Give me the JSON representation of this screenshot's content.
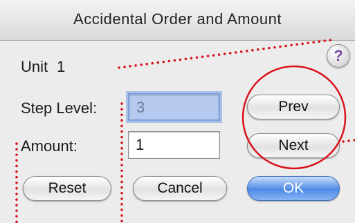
{
  "window": {
    "title": "Accidental Order and Amount"
  },
  "unit": {
    "label": "Unit",
    "value": "1"
  },
  "step_level": {
    "label": "Step Level:",
    "value": "3"
  },
  "amount": {
    "label": "Amount:",
    "value": "1"
  },
  "help": {
    "glyph": "?"
  },
  "buttons": {
    "prev": "Prev",
    "next": "Next",
    "reset": "Reset",
    "cancel": "Cancel",
    "ok": "OK"
  },
  "colors": {
    "annotation_red": "#d9121b",
    "default_button": "#4d8ae6",
    "focus_field": "#b6c9ef"
  }
}
